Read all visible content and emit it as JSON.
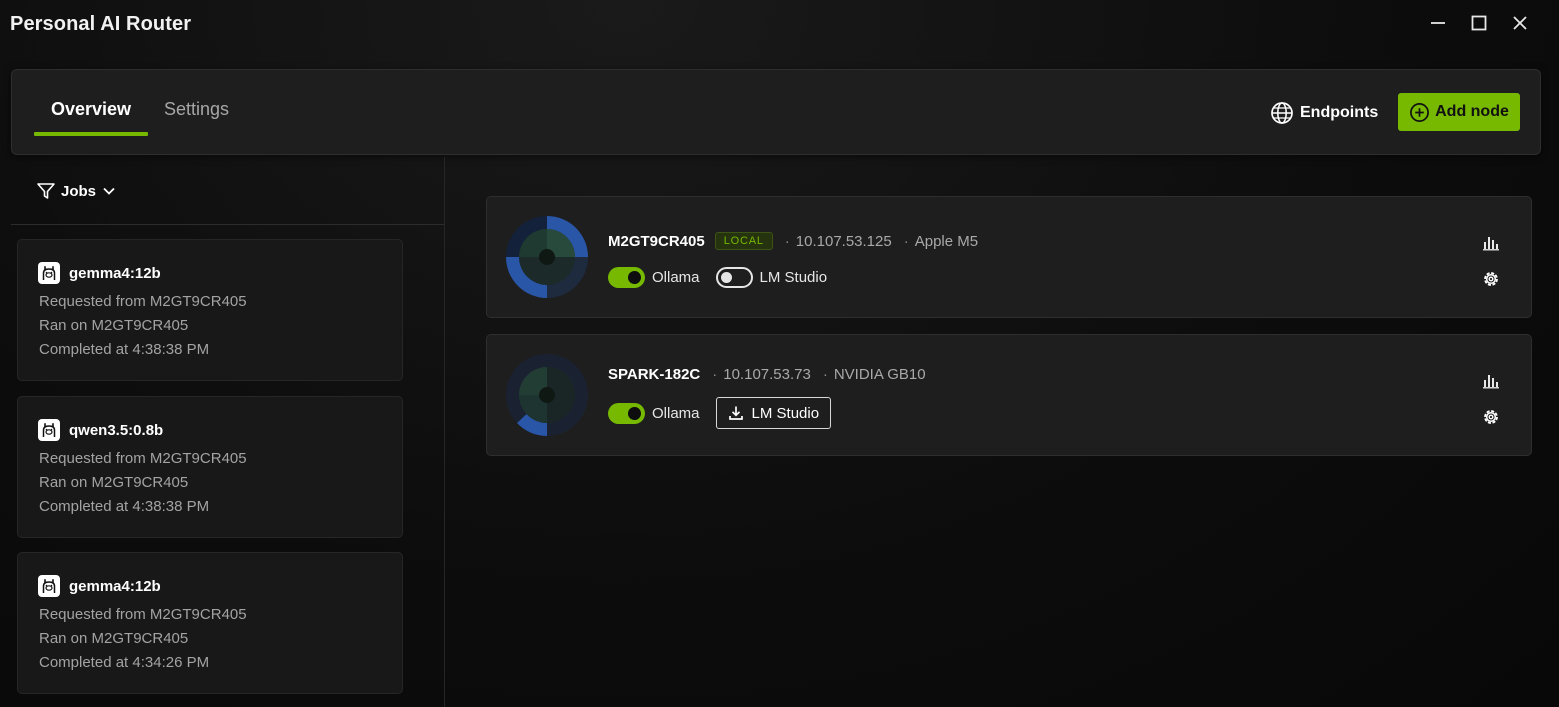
{
  "window": {
    "title": "Personal AI Router",
    "controls": {
      "minimize": "minimize-icon",
      "maximize": "maximize-icon",
      "close": "close-icon"
    }
  },
  "nav": {
    "tabs": [
      {
        "label": "Overview",
        "active": true
      },
      {
        "label": "Settings",
        "active": false
      }
    ],
    "endpoints_label": "Endpoints",
    "add_node_label": "Add node"
  },
  "jobs_panel": {
    "filter_label": "Jobs",
    "jobs": [
      {
        "model": "gemma4:12b",
        "requested": "Requested from M2GT9CR405",
        "ran": "Ran on M2GT9CR405",
        "completed": "Completed at 4:38:38 PM"
      },
      {
        "model": "qwen3.5:0.8b",
        "requested": "Requested from M2GT9CR405",
        "ran": "Ran on M2GT9CR405",
        "completed": "Completed at 4:38:38 PM"
      },
      {
        "model": "gemma4:12b",
        "requested": "Requested from M2GT9CR405",
        "ran": "Ran on M2GT9CR405",
        "completed": "Completed at 4:34:26 PM"
      }
    ]
  },
  "nodes": [
    {
      "name": "M2GT9CR405",
      "badge": "LOCAL",
      "ip": "10.107.53.125",
      "hardware": "Apple M5",
      "runtimes": [
        {
          "label": "Ollama",
          "state": "on"
        },
        {
          "label": "LM Studio",
          "state": "off"
        }
      ]
    },
    {
      "name": "SPARK-182C",
      "ip": "10.107.53.73",
      "hardware": "NVIDIA GB10",
      "runtimes": [
        {
          "label": "Ollama",
          "state": "on"
        },
        {
          "label": "LM Studio",
          "state": "install"
        }
      ]
    }
  ],
  "separator": "·",
  "colors": {
    "accent": "#76b900",
    "background": "#0b0b0b",
    "card": "#1e1e1e",
    "avatar_blue": "#2a56a8"
  }
}
